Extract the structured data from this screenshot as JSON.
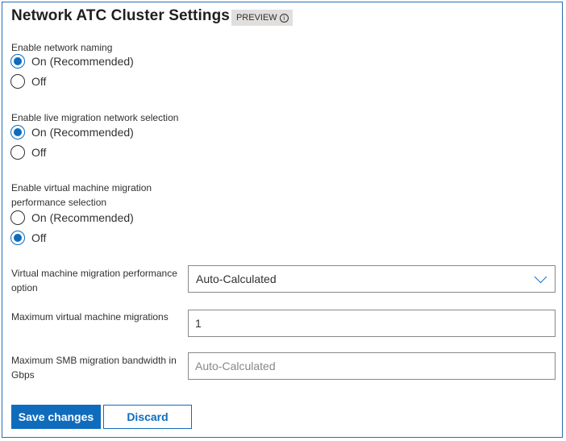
{
  "header": {
    "title": "Network ATC Cluster Settings",
    "badge": "PREVIEW",
    "info_icon": "info-icon"
  },
  "groups": [
    {
      "label": "Enable network naming",
      "options": [
        {
          "label": "On (Recommended)",
          "checked": true
        },
        {
          "label": "Off",
          "checked": false
        }
      ]
    },
    {
      "label": "Enable live migration network selection",
      "options": [
        {
          "label": "On (Recommended)",
          "checked": true
        },
        {
          "label": "Off",
          "checked": false
        }
      ]
    },
    {
      "label_lines": [
        "Enable virtual machine migration",
        "performance selection"
      ],
      "options": [
        {
          "label": "On (Recommended)",
          "checked": false
        },
        {
          "label": "Off",
          "checked": true
        }
      ]
    }
  ],
  "fields": {
    "performance_option": {
      "label_lines": [
        "Virtual machine migration performance",
        "option"
      ],
      "value": "Auto-Calculated",
      "icon": "chevron-down-icon"
    },
    "max_vm_migrations": {
      "label": "Maximum virtual machine migrations",
      "value": "1"
    },
    "max_smb_bandwidth": {
      "label_lines": [
        "Maximum SMB migration bandwidth in",
        "Gbps"
      ],
      "value": "",
      "placeholder": "Auto-Calculated"
    }
  },
  "actions": {
    "save_label": "Save changes",
    "discard_label": "Discard"
  },
  "colors": {
    "accent": "#0f6cbd",
    "border": "#2b6cb0",
    "badge_bg": "#e1dfdd"
  }
}
